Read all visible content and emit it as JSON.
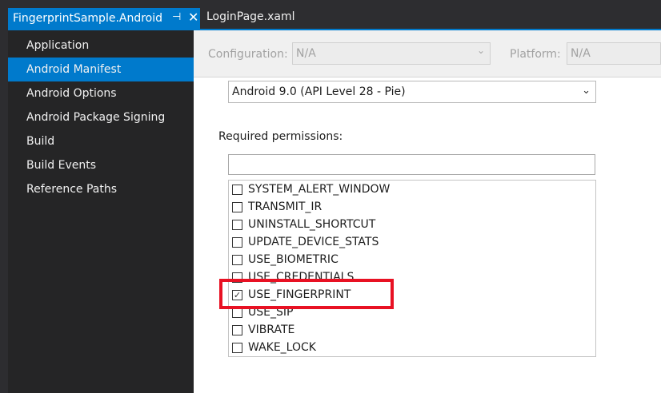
{
  "tabs": {
    "active_label": "FingerprintSample.Android",
    "pin_glyph": "⊣",
    "close_glyph": "✕",
    "second_label": "LoginPage.xaml"
  },
  "sidebar": {
    "items": [
      {
        "label": "Application"
      },
      {
        "label": "Android Manifest"
      },
      {
        "label": "Android Options"
      },
      {
        "label": "Android Package Signing"
      },
      {
        "label": "Build"
      },
      {
        "label": "Build Events"
      },
      {
        "label": "Reference Paths"
      }
    ],
    "selected_index": 1
  },
  "config": {
    "configuration_label": "Configuration:",
    "configuration_value": "N/A",
    "platform_label": "Platform:",
    "platform_value": "N/A"
  },
  "api_level": {
    "value": "Android 9.0 (API Level 28 - Pie)"
  },
  "permissions": {
    "label": "Required permissions:",
    "filter_value": "",
    "items": [
      {
        "name": "SYSTEM_ALERT_WINDOW",
        "checked": false
      },
      {
        "name": "TRANSMIT_IR",
        "checked": false
      },
      {
        "name": "UNINSTALL_SHORTCUT",
        "checked": false
      },
      {
        "name": "UPDATE_DEVICE_STATS",
        "checked": false
      },
      {
        "name": "USE_BIOMETRIC",
        "checked": false
      },
      {
        "name": "USE_CREDENTIALS",
        "checked": false
      },
      {
        "name": "USE_FINGERPRINT",
        "checked": true
      },
      {
        "name": "USE_SIP",
        "checked": false
      },
      {
        "name": "VIBRATE",
        "checked": false
      },
      {
        "name": "WAKE_LOCK",
        "checked": false
      }
    ]
  },
  "colors": {
    "accent": "#007acc",
    "highlight": "#e81123"
  }
}
